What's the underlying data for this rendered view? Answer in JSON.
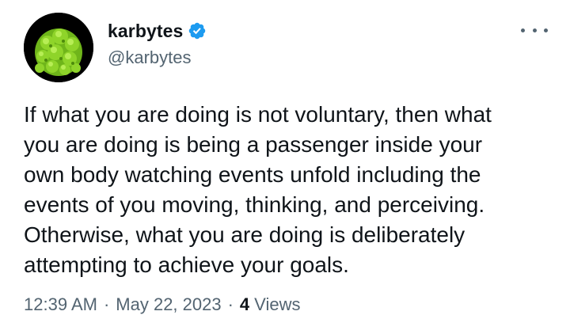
{
  "tweet": {
    "display_name": "karbytes",
    "handle": "@karbytes",
    "verified": true,
    "text": "If what you are doing is not voluntary, then what\nyou are doing is being a passenger inside your\nown body watching events unfold including the\nevents of you moving, thinking, and perceiving.\nOtherwise, what you are doing is deliberately\nattempting to achieve your goals.",
    "time": "12:39 AM",
    "separator": "·",
    "date": "May 22, 2023",
    "views_count": "4",
    "views_label": "Views"
  },
  "icons": {
    "avatar": "romanesco-broccoli-avatar",
    "verified": "verified-badge-icon",
    "more": "more-options-icon"
  },
  "colors": {
    "verified_blue": "#1d9bf0",
    "secondary_text": "#536471",
    "primary_text": "#0f1419",
    "avatar_green": "#7dc21e"
  }
}
